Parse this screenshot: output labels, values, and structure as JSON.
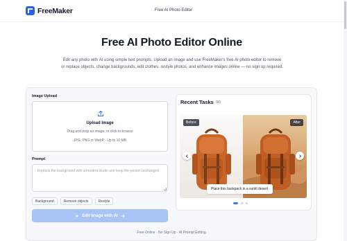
{
  "header": {
    "brand": "FreeMaker",
    "nav_link": "Free AI Photo Editor"
  },
  "hero": {
    "title": "Free AI Photo Editor Online",
    "description": "Edit any photo with AI using simple text prompts. Upload an image and use FreeMaker's free AI photo editor to remove or replace objects, change backgrounds, edit clothes, restyle photos, and enhance images online — no sign up required."
  },
  "upload": {
    "section_label": "Image Upload",
    "title": "Upload Image",
    "hint": "Drag and drop an image, or click to browse",
    "formats": "JPG, PNG or WebP · Up to 10 MB",
    "icon": "upload-icon"
  },
  "prompt": {
    "section_label": "Prompt",
    "placeholder": "Replace the background with a modern studio and keep the person unchanged",
    "chips": [
      "Background",
      "Remove objects",
      "Restyle"
    ]
  },
  "action": {
    "edit_label": "Edit Image with AI",
    "icon": "sparkle-icon"
  },
  "footer": {
    "note": "Free Online · No Sign Up · AI Prompt Editing"
  },
  "tasks": {
    "title": "Recent Tasks",
    "count": "0/8",
    "before_label": "Before",
    "after_label": "After",
    "caption": "Place this backpack in a sunlit desert.",
    "slide_count": 3,
    "active_slide": 0
  },
  "colors": {
    "brand": "#2563eb",
    "button_disabled": "#a8c4f7",
    "dot_active": "#3b82f6",
    "backpack": "#c8662a"
  }
}
